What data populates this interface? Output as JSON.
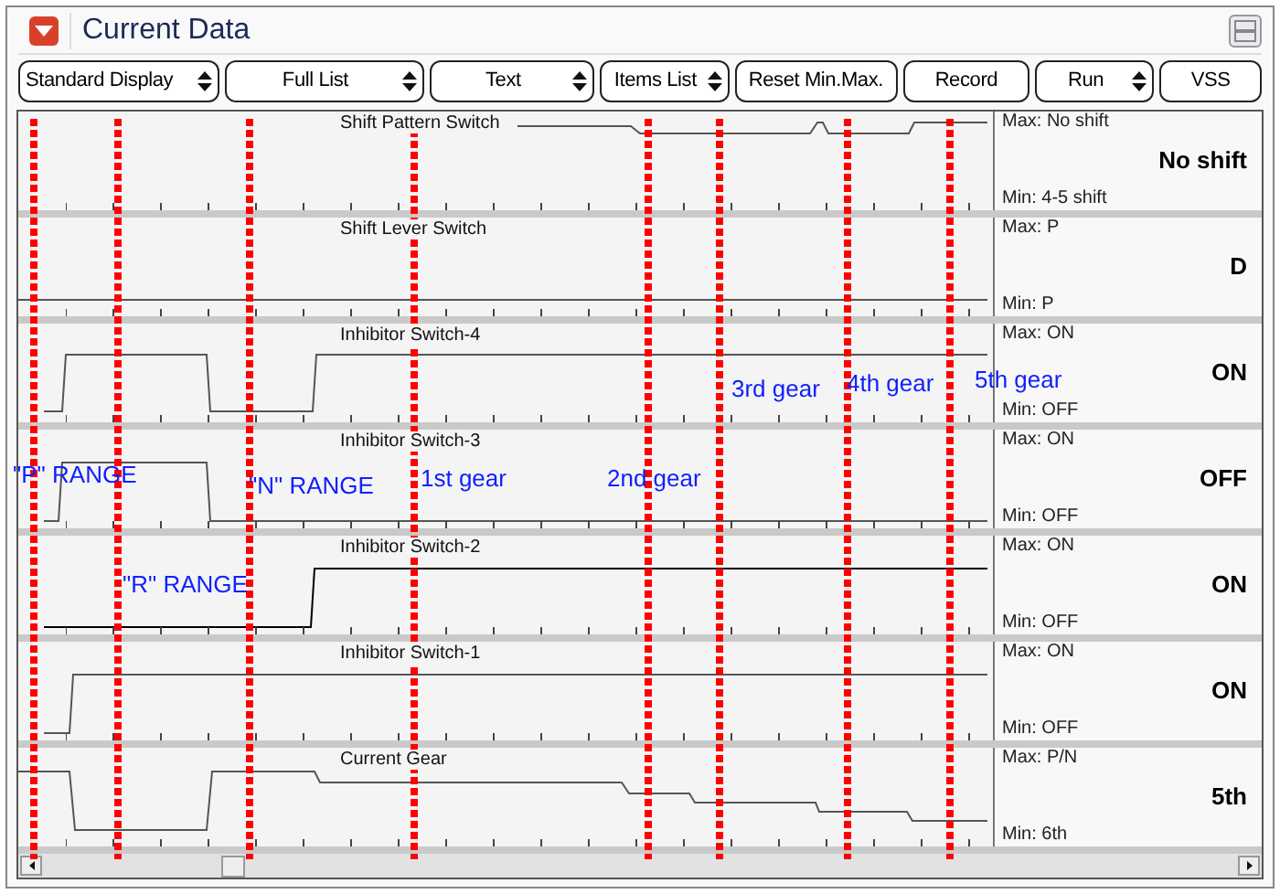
{
  "window": {
    "title": "Current Data"
  },
  "toolbar": [
    {
      "label": "Standard Display",
      "kind": "select"
    },
    {
      "label": "Full List",
      "kind": "select"
    },
    {
      "label": "Text",
      "kind": "select"
    },
    {
      "label": "Items List",
      "kind": "select"
    },
    {
      "label": "Reset Min.Max.",
      "kind": "button"
    },
    {
      "label": "Record",
      "kind": "button"
    },
    {
      "label": "Run",
      "kind": "select"
    },
    {
      "label": "VSS",
      "kind": "button"
    }
  ],
  "rows": [
    {
      "name": "Shift Pattern Switch",
      "max": "Max: No shift",
      "value": "No shift",
      "min": "Min:  4-5 shift"
    },
    {
      "name": "Shift Lever Switch",
      "max": "Max: P",
      "value": "D",
      "min": "Min:  P"
    },
    {
      "name": "Inhibitor Switch-4",
      "max": "Max: ON",
      "value": "ON",
      "min": "Min:  OFF"
    },
    {
      "name": "Inhibitor Switch-3",
      "max": "Max: ON",
      "value": "OFF",
      "min": "Min:  OFF"
    },
    {
      "name": "Inhibitor Switch-2",
      "max": "Max: ON",
      "value": "ON",
      "min": "Min:  OFF"
    },
    {
      "name": "Inhibitor Switch-1",
      "max": "Max: ON",
      "value": "ON",
      "min": "Min:  OFF"
    },
    {
      "name": "Current Gear",
      "max": "Max: P/N",
      "value": "5th",
      "min": "Min:  6th"
    }
  ],
  "annotations": [
    "3rd gear",
    "4th gear",
    "5th gear",
    "\"P\" RANGE",
    "\"N\" RANGE",
    "1st gear",
    "2nd gear",
    "\"R\" RANGE"
  ]
}
